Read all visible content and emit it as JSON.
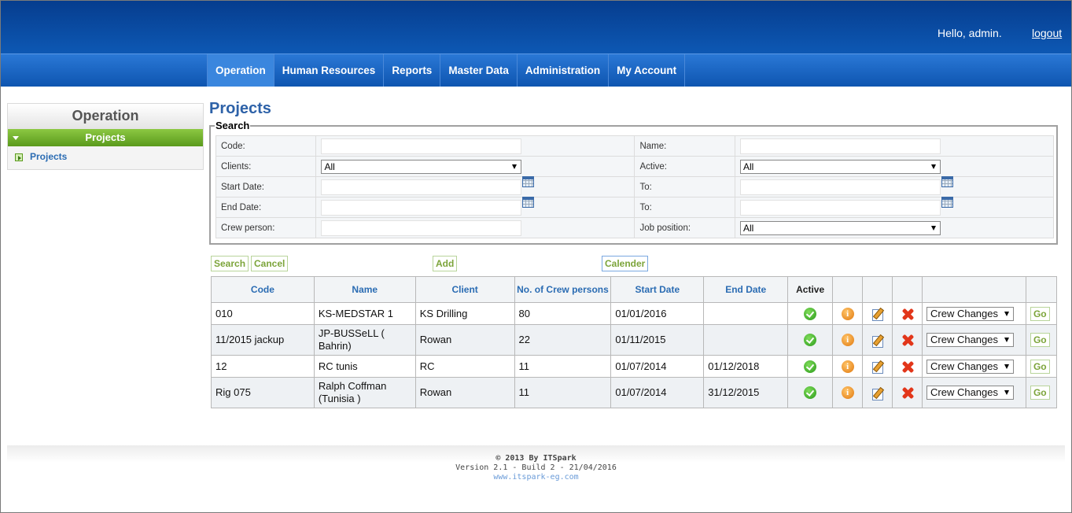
{
  "header": {
    "greeting": "Hello, admin.",
    "logout": "logout"
  },
  "nav": [
    "Operation",
    "Human Resources",
    "Reports",
    "Master Data",
    "Administration",
    "My Account"
  ],
  "sidebar": {
    "title": "Operation",
    "section": "Projects",
    "item": "Projects"
  },
  "page": {
    "title": "Projects"
  },
  "search": {
    "legend": "Search",
    "code_label": "Code:",
    "name_label": "Name:",
    "clients_label": "Clients:",
    "clients_value": "All",
    "active_label": "Active:",
    "active_value": "All",
    "start_date_label": "Start Date:",
    "to1_label": "To:",
    "end_date_label": "End Date:",
    "to2_label": "To:",
    "crew_label": "Crew person:",
    "job_label": "Job position:",
    "job_value": "All"
  },
  "buttons": {
    "search": "Search",
    "cancel": "Cancel",
    "add": "Add",
    "calendar": "Calender"
  },
  "table": {
    "headers": [
      "Code",
      "Name",
      "Client",
      "No. of Crew persons",
      "Start Date",
      "End Date",
      "Active"
    ],
    "action_select": "Crew Changes",
    "go": "Go",
    "info_glyph": "i",
    "rows": [
      {
        "code": "010",
        "name": "KS-MEDSTAR 1",
        "client": "KS Drilling",
        "crew": "80",
        "start": "01/01/2016",
        "end": ""
      },
      {
        "code": "11/2015 jackup",
        "name": "JP-BUSSeLL ( Bahrin)",
        "client": "Rowan",
        "crew": "22",
        "start": "01/11/2015",
        "end": ""
      },
      {
        "code": "12",
        "name": "RC tunis",
        "client": "RC",
        "crew": "11",
        "start": "01/07/2014",
        "end": "01/12/2018"
      },
      {
        "code": "Rig 075",
        "name": "Ralph Coffman (Tunisia )",
        "client": "Rowan",
        "crew": "11",
        "start": "01/07/2014",
        "end": "31/12/2015"
      }
    ]
  },
  "footer": {
    "copyright": "© 2013 By ITSpark",
    "version": "Version 2.1 - Build 2 - 21/04/2016",
    "url": "www.itspark-eg.com"
  }
}
